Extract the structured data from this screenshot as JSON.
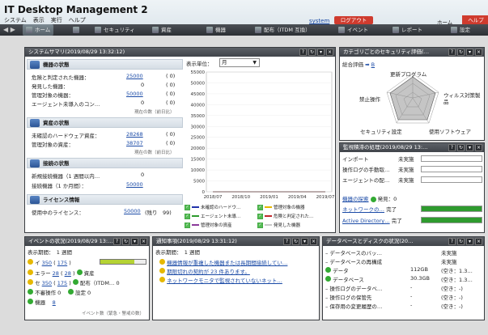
{
  "app": {
    "title": "IT Desktop Management 2",
    "menu": [
      "システム",
      "表示",
      "実行",
      "ヘルプ"
    ],
    "system_link": "system",
    "logout": "ログアウト",
    "home": "ホーム",
    "help": "ヘルプ"
  },
  "nav": {
    "items": [
      "ホーム",
      "セキュリティ",
      "資産",
      "機器",
      "配布（ITDM 互換）",
      "イベント",
      "レポート",
      "設定"
    ]
  },
  "summary": {
    "title": "システムサマリ(2019/08/29 13:32:12)",
    "device_status": {
      "label": "機器の状態",
      "rows": [
        {
          "label": "危険と判定された機器：",
          "value": "25000",
          "count": "(   0)"
        },
        {
          "label": "発見した機器：",
          "value": "0",
          "count": "(   0)"
        },
        {
          "label": "管理対象の機器：",
          "value": "50000",
          "count": "(   0)"
        },
        {
          "label": "エージェント未導入のコン…",
          "value": "0",
          "count": "(   0)"
        }
      ],
      "note": "現在の数（前日比）"
    },
    "asset_status": {
      "label": "資産の状態",
      "rows": [
        {
          "label": "未確認のハードウェア資産：",
          "value": "28268",
          "count": "(   0)"
        },
        {
          "label": "管理対象の資産：",
          "value": "38707",
          "count": "(   0)"
        }
      ],
      "note": "現在の数（前日比）"
    },
    "connection_status": {
      "label": "接続の状態",
      "rows": [
        {
          "label": "新規接続機器（1 週間以内…",
          "value": "0"
        },
        {
          "label": "接続機器（1 か月間）：",
          "value": "50000"
        }
      ]
    },
    "license": {
      "label": "ライセンス情報",
      "row": {
        "label": "使用中のライセンス：",
        "value": "50000",
        "remain": "(残り　99)"
      }
    },
    "unit_label": "表示単位：",
    "unit_value": "月"
  },
  "chart_data": {
    "type": "line",
    "x": [
      "2018/07",
      "2018/10",
      "2019/01",
      "2019/04",
      "2019/07"
    ],
    "ylim": [
      0,
      55000
    ],
    "yticks": [
      "55000",
      "50000",
      "45000",
      "40000",
      "35000",
      "30000",
      "25000",
      "20000",
      "15000",
      "10000",
      "5000",
      "0"
    ],
    "series": [
      {
        "name": "未確認のハードウ…",
        "color": "#2233aa",
        "values": [
          0,
          0,
          0,
          0,
          0,
          0,
          0,
          0,
          0,
          0,
          0,
          0,
          0
        ]
      },
      {
        "name": "管理対象の機器",
        "color": "#e6b800",
        "values": [
          0,
          0,
          0,
          0,
          0,
          0,
          0,
          0,
          0,
          0,
          0,
          0,
          0
        ]
      },
      {
        "name": "エージェント未導…",
        "color": "#2e9b2e",
        "values": [
          0,
          0,
          0,
          0,
          0,
          0,
          0,
          0,
          0,
          0,
          0,
          0,
          0
        ]
      },
      {
        "name": "危険と判定された…",
        "color": "#c0282d",
        "values": [
          0,
          0,
          0,
          0,
          0,
          0,
          0,
          0,
          0,
          0,
          0,
          0,
          0
        ]
      },
      {
        "name": "管理対象の資産",
        "color": "#8a3a9a",
        "values": [
          0,
          0,
          0,
          0,
          0,
          0,
          0,
          0,
          0,
          0,
          0,
          0,
          0
        ]
      },
      {
        "name": "発見した機器",
        "color": "#c9c9c9",
        "values": [
          0,
          0,
          0,
          0,
          0,
          0,
          0,
          0,
          0,
          0,
          0,
          0,
          0
        ]
      }
    ]
  },
  "category": {
    "title": "カテゴリごとのセキュリティ評価(…",
    "overall_label": "総合評価",
    "overall_value": "B",
    "axes": [
      "更新プログラム",
      "ウィルス対策製品",
      "使用ソフトウェア",
      "セキュリティ設定",
      "禁止操作"
    ]
  },
  "monitor": {
    "title": "監視積滞の処理(2019/08/29 13:…",
    "rows": [
      {
        "label": "インポート",
        "status": "未実施"
      },
      {
        "label": "操作ログの手動取…",
        "status": "未実施"
      },
      {
        "label": "エージェントの配…",
        "status": "未実施"
      }
    ],
    "search_link": "機器の探索",
    "discover_label": "発見：0",
    "links": [
      {
        "label": "ネットワークの…",
        "status": "完了"
      },
      {
        "label": "Active Directory…",
        "status": "完了"
      }
    ]
  },
  "events": {
    "title": "イベントの状況(2019/08/29 13:…",
    "period": "表示期間：　1 週間",
    "rows": [
      {
        "c1": "イ",
        "v1": "350",
        "v2": "175",
        "pct": 0.75
      },
      {
        "c1": "エラー",
        "v1": "28",
        "v2": "28",
        "label2": "資産"
      },
      {
        "c1": "セ",
        "v1": "350",
        "v2": "175",
        "label2": "配布（ITDM…",
        "v3": "0"
      },
      {
        "c1": "不審操作",
        "v1": "0",
        "label2": "設定",
        "v3": "0"
      },
      {
        "c1": "機器",
        "v1": "8"
      }
    ],
    "note": "イベント数（緊急・警戒の数）"
  },
  "notices": {
    "title": "通知事項(2019/08/29 13:31:12)",
    "period": "表示期間：　1 週間",
    "items": [
      "機器情報が重複した機器または長期間接続してい…",
      "期限切れの契約が 23 件あります。",
      "ネットワークモニタで監視されていないネット…"
    ]
  },
  "db": {
    "title": "データベースとディスクの状況(20…",
    "rows": [
      {
        "name": "データベースのバッ…",
        "size": "",
        "status": "未実施"
      },
      {
        "name": "データベースの再構成",
        "size": "",
        "status": "未実施"
      },
      {
        "name": "データ",
        "size": "112GB",
        "status": "(空き：1.3…"
      },
      {
        "name": "データベース",
        "size": "30.3GB",
        "status": "(空き：1.3…"
      },
      {
        "name": "操作ログのデータベ…",
        "size": "-",
        "status": "(空き：-)"
      },
      {
        "name": "操作ログの保管先",
        "size": "-",
        "status": "(空き：-)"
      },
      {
        "name": "保存用の変更履歴の…",
        "size": "-",
        "status": "(空き：-)"
      }
    ]
  }
}
